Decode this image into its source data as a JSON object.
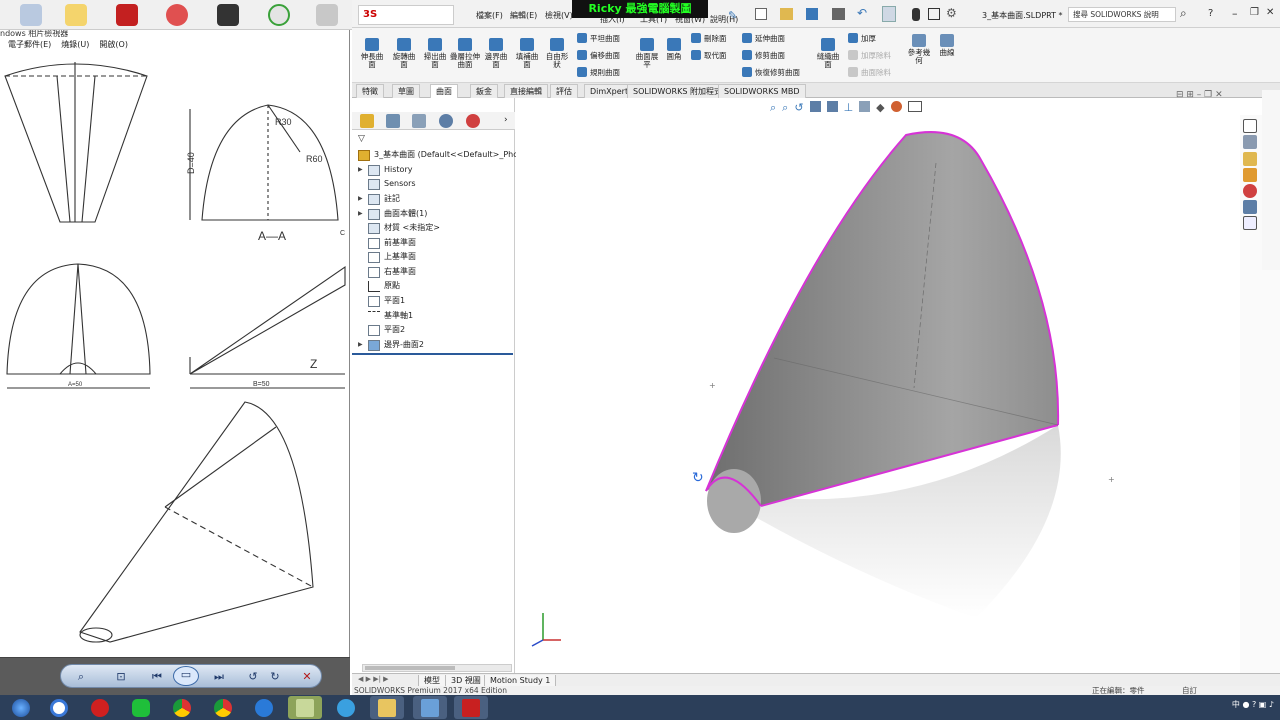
{
  "viewer": {
    "title": "ndows 相片檢視器",
    "menus": [
      "電子郵件(E)",
      "燒錄(U)",
      "開啟(O)"
    ],
    "drawing_labels": {
      "r_label": "R30",
      "r2_label": "R60",
      "d_label": "D=40",
      "section": "A—A",
      "a_label": "A=50",
      "b_label": "B=50",
      "z_label": "Z",
      "c_label": "C"
    }
  },
  "sw": {
    "logo": "3S SOLIDWORKS",
    "menu": [
      "檔案(F)",
      "編輯(E)",
      "檢視(V)",
      "插入(I)",
      "工具(T)",
      "視窗(W)",
      "說明(H)"
    ],
    "banner": "Ricky 最強電腦製圖",
    "doc_title": "3_基本曲面.SLDPRT *",
    "help_search": "搜尋 SOLIDWORKS 說明",
    "ribbon_big": [
      {
        "label": "伸長曲面",
        "color": "#3a78b8"
      },
      {
        "label": "旋轉曲面",
        "color": "#3a78b8"
      },
      {
        "label": "掃出曲面",
        "color": "#3a78b8"
      },
      {
        "label": "疊層拉伸曲面",
        "color": "#3a78b8"
      },
      {
        "label": "邊界曲面",
        "color": "#3a78b8"
      },
      {
        "label": "填補曲面",
        "color": "#3a78b8"
      },
      {
        "label": "自由形狀",
        "color": "#3a78b8"
      }
    ],
    "ribbon_small_col1": [
      "平坦曲面",
      "偏移曲面",
      "規則曲面"
    ],
    "ribbon_mid": [
      "曲面展平",
      "圓角"
    ],
    "ribbon_small_col2": [
      "刪除面",
      "取代面"
    ],
    "ribbon_small_col3": [
      "延伸曲面",
      "修剪曲面",
      "恢復修剪曲面"
    ],
    "ribbon_knit": "縫織曲面",
    "ribbon_small_col4": [
      "加厚",
      "加厚除料",
      "曲面除料"
    ],
    "ribbon_ref": [
      "參考幾何",
      "曲線"
    ],
    "tabs": [
      "特徵",
      "草圖",
      "曲面",
      "鈑金",
      "直接編輯",
      "評估",
      "DimXpert",
      "SOLIDWORKS 附加程式",
      "SOLIDWORKS MBD"
    ],
    "active_tab": "曲面",
    "tree": [
      {
        "label": "3_基本曲面 (Default<<Default>_Photo",
        "expand": ""
      },
      {
        "label": "History",
        "expand": "▶"
      },
      {
        "label": "Sensors",
        "expand": ""
      },
      {
        "label": "註記",
        "expand": "▶"
      },
      {
        "label": "曲面本體(1)",
        "expand": "▶"
      },
      {
        "label": "材質 <未指定>",
        "expand": ""
      },
      {
        "label": "前基準面",
        "expand": ""
      },
      {
        "label": "上基準面",
        "expand": ""
      },
      {
        "label": "右基準面",
        "expand": ""
      },
      {
        "label": "原點",
        "expand": ""
      },
      {
        "label": "平面1",
        "expand": ""
      },
      {
        "label": "基準軸1",
        "expand": ""
      },
      {
        "label": "平面2",
        "expand": ""
      },
      {
        "label": "邊界-曲面2",
        "expand": "▶"
      }
    ],
    "bottom_tabs": [
      "模型",
      "3D 視圖",
      "Motion Study 1"
    ],
    "status": "SOLIDWORKS Premium 2017 x64 Edition",
    "status_right": [
      "正在編輯：零件",
      "自訂"
    ]
  },
  "taskbar": {
    "clock": "",
    "ime": "中"
  },
  "colors": {
    "accent": "#3a78b8",
    "edge_highlight": "#d633d6",
    "banner_text": "#23ff23"
  }
}
